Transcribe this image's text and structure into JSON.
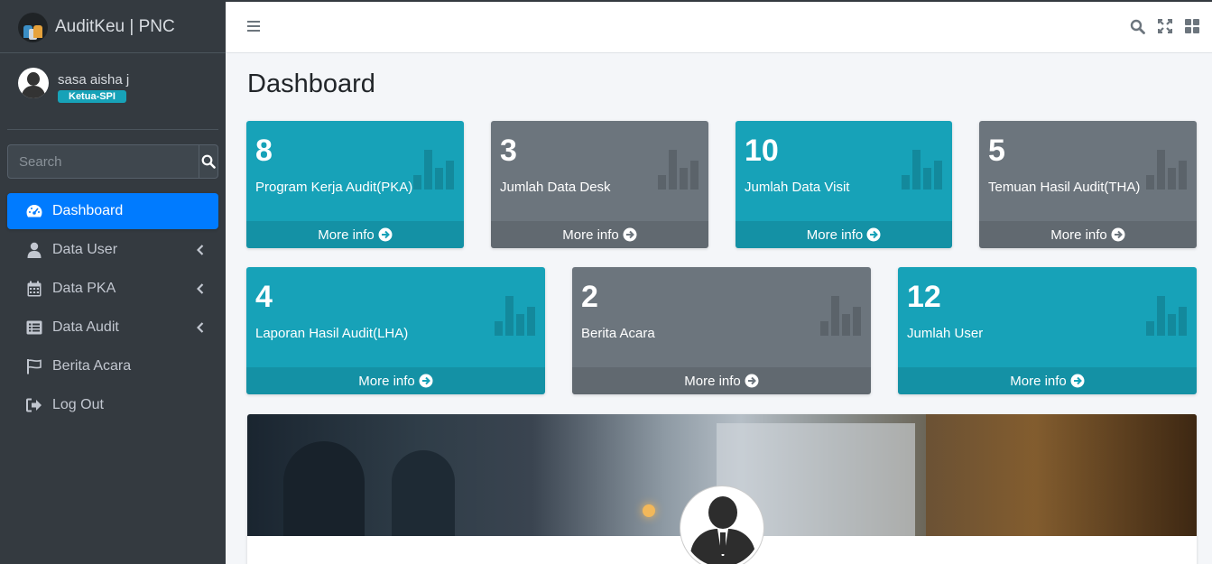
{
  "brand": {
    "title": "AuditKeu | PNC"
  },
  "user": {
    "name": "sasa aisha j",
    "role": "Ketua-SPI"
  },
  "search": {
    "placeholder": "Search"
  },
  "nav": [
    {
      "label": "Dashboard",
      "icon": "tachometer-icon",
      "active": true
    },
    {
      "label": "Data User",
      "icon": "user-icon",
      "has_submenu": true
    },
    {
      "label": "Data PKA",
      "icon": "calendar-icon",
      "has_submenu": true
    },
    {
      "label": "Data Audit",
      "icon": "list-icon",
      "has_submenu": true
    },
    {
      "label": "Berita Acara",
      "icon": "flag-icon"
    },
    {
      "label": "Log Out",
      "icon": "sign-out-icon"
    }
  ],
  "page": {
    "title": "Dashboard"
  },
  "boxes": [
    {
      "value": "8",
      "label": "Program Kerja Audit(PKA)",
      "footer": "More info",
      "color": "#17a2b8"
    },
    {
      "value": "3",
      "label": "Jumlah Data Desk",
      "footer": "More info",
      "color": "#6c757d"
    },
    {
      "value": "10",
      "label": "Jumlah Data Visit",
      "footer": "More info",
      "color": "#17a2b8"
    },
    {
      "value": "5",
      "label": "Temuan Hasil Audit(THA)",
      "footer": "More info",
      "color": "#6c757d"
    },
    {
      "value": "4",
      "label": "Laporan Hasil Audit(LHA)",
      "footer": "More info",
      "color": "#17a2b8"
    },
    {
      "value": "2",
      "label": "Berita Acara",
      "footer": "More info",
      "color": "#6c757d"
    },
    {
      "value": "12",
      "label": "Jumlah User",
      "footer": "More info",
      "color": "#17a2b8"
    }
  ],
  "colors": {
    "sidebar": "#343a40",
    "active": "#007bff",
    "info": "#17a2b8",
    "secondary": "#6c757d"
  }
}
